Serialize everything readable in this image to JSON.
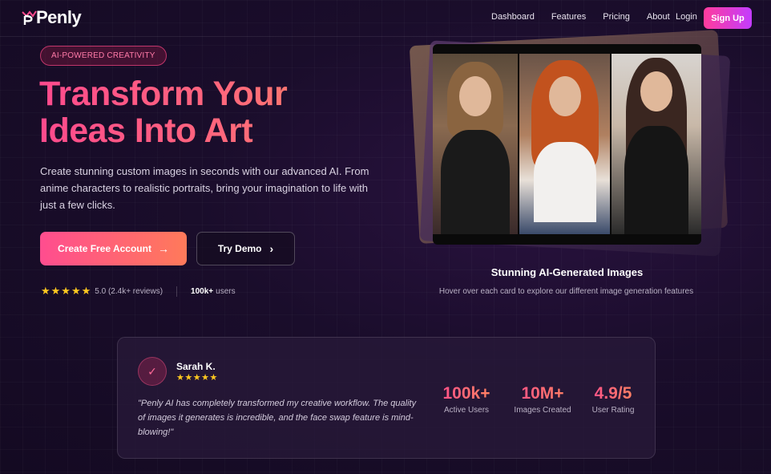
{
  "brand": {
    "name": "Penly"
  },
  "nav": {
    "links": [
      "Dashboard",
      "Features",
      "Pricing",
      "About"
    ],
    "login": "Login",
    "signup": "Sign Up"
  },
  "hero": {
    "badge": "AI-POWERED CREATIVITY",
    "headline_line1": "Transform Your",
    "headline_line2": "Ideas Into Art",
    "subtext": "Create stunning custom images in seconds with our advanced AI. From anime characters to realistic portraits, bring your imagination to life with just a few clicks.",
    "cta_primary": "Create Free Account",
    "cta_secondary": "Try Demo",
    "rating": "5.0 (2.4k+ reviews)",
    "users_count": "100k+",
    "users_label": "users"
  },
  "gallery": {
    "title": "Stunning AI-Generated Images",
    "subtitle": "Hover over each card to explore our different image generation features"
  },
  "testimonial": {
    "name": "Sarah K.",
    "quote": "\"Penly AI has completely transformed my creative workflow. The quality of images it generates is incredible, and the face swap feature is mind-blowing!\"",
    "stats": [
      {
        "value": "100k+",
        "label": "Active Users"
      },
      {
        "value": "10M+",
        "label": "Images Created"
      },
      {
        "value": "4.9/5",
        "label": "User Rating"
      }
    ]
  },
  "colors": {
    "accent_pink": "#ff4a8d",
    "accent_orange": "#ff8a5c",
    "signup_gradient_end": "#c33cff",
    "star": "#ffc820",
    "background": "#1a0d2b"
  }
}
